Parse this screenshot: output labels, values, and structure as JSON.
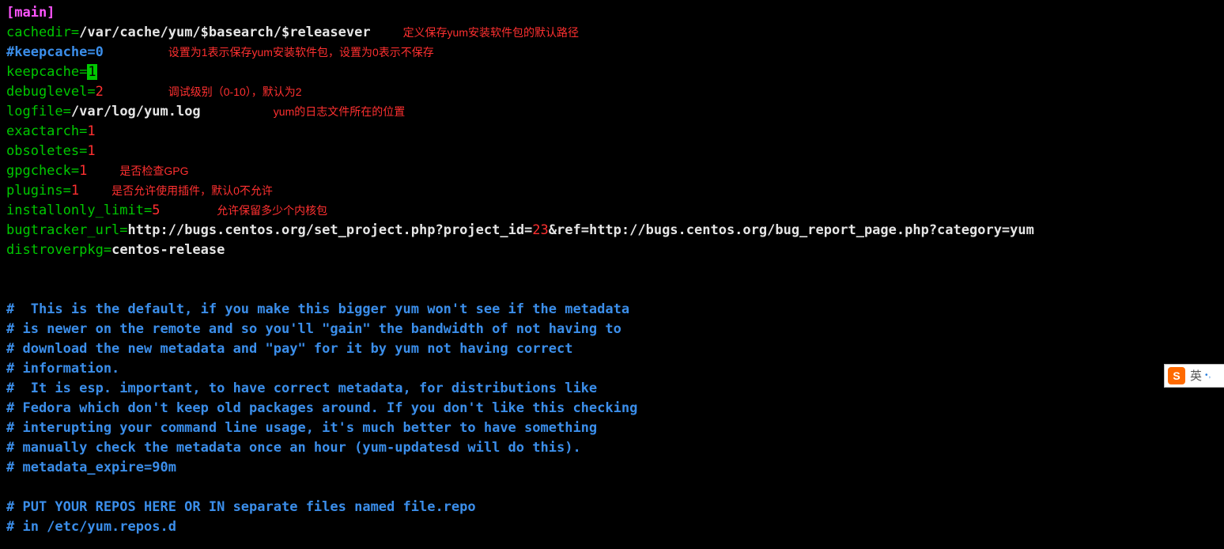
{
  "section_header": "[main]",
  "l_cachedir_key": "cachedir",
  "l_cachedir_eq": "=",
  "l_cachedir_val": "/var/cache/yum/$basearch/$releasever",
  "l_cachedir_annot": "定义保存yum安装软件包的默认路径",
  "l_keepcache0": "#keepcache=0",
  "l_keepcache0_annot": "设置为1表示保存yum安装软件包，设置为0表示不保存",
  "l_keepcache_key": "keepcache",
  "l_keepcache_eq": "=",
  "l_keepcache_cursor": "1",
  "l_debuglevel_key": "debuglevel",
  "l_debuglevel_eq": "=",
  "l_debuglevel_val": "2",
  "l_debuglevel_annot": "调试级别（0-10），默认为2",
  "l_logfile_key": "logfile",
  "l_logfile_eq": "=",
  "l_logfile_val": "/var/log/yum.log",
  "l_logfile_annot": "yum的日志文件所在的位置",
  "l_exactarch_key": "exactarch",
  "l_exactarch_eq": "=",
  "l_exactarch_val": "1",
  "l_obsoletes_key": "obsoletes",
  "l_obsoletes_eq": "=",
  "l_obsoletes_val": "1",
  "l_gpgcheck_key": "gpgcheck",
  "l_gpgcheck_eq": "=",
  "l_gpgcheck_val": "1",
  "l_gpgcheck_annot": "是否检查GPG",
  "l_plugins_key": "plugins",
  "l_plugins_eq": "=",
  "l_plugins_val": "1",
  "l_plugins_annot": "是否允许使用插件，默认0不允许",
  "l_installonly_key": "installonly_limit",
  "l_installonly_eq": "=",
  "l_installonly_val": "5",
  "l_installonly_annot": "允许保留多少个内核包",
  "l_bugtracker_key": "bugtracker_url",
  "l_bugtracker_eq": "=",
  "l_bugtracker_pre": "http://bugs.centos.org/set_project.php?project_id=",
  "l_bugtracker_num": "23",
  "l_bugtracker_post": "&ref=http://bugs.centos.org/bug_report_page.php?category=yum",
  "l_distro_key": "distroverpkg",
  "l_distro_eq": "=",
  "l_distro_val": "centos-release",
  "c1": "#  This is the default, if you make this bigger yum won't see if the metadata",
  "c2": "# is newer on the remote and so you'll \"gain\" the bandwidth of not having to",
  "c3": "# download the new metadata and \"pay\" for it by yum not having correct",
  "c4": "# information.",
  "c5": "#  It is esp. important, to have correct metadata, for distributions like",
  "c6": "# Fedora which don't keep old packages around. If you don't like this checking",
  "c7": "# interupting your command line usage, it's much better to have something",
  "c8": "# manually check the metadata once an hour (yum-updatesd will do this).",
  "c9": "# metadata_expire=90m",
  "c10": "# PUT YOUR REPOS HERE OR IN separate files named file.repo",
  "c11": "# in /etc/yum.repos.d",
  "ime_logo": "S",
  "ime_lang": "英",
  "ime_dots": "•,"
}
